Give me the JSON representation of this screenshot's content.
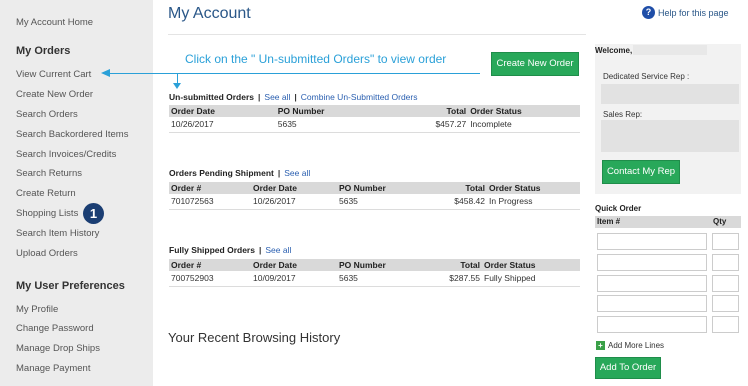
{
  "sidebar": {
    "home": "My Account Home",
    "orders_heading": "My Orders",
    "orders_items": [
      "View Current Cart",
      "Create New Order",
      "Search Orders",
      "Search Backordered Items",
      "Search Invoices/Credits",
      "Search Returns",
      "Create Return",
      "Shopping Lists",
      "Search Item History",
      "Upload Orders"
    ],
    "prefs_heading": "My User Preferences",
    "prefs_items": [
      "My Profile",
      "Change Password",
      "Manage Drop Ships",
      "Manage Payment"
    ],
    "badge": "1"
  },
  "header": {
    "title": "My Account",
    "help": "Help for this page",
    "help_icon": "?"
  },
  "callout": "Click on the \" Un-submitted Orders\" to view order",
  "create_button": "Create New Order",
  "unsubmitted": {
    "title": "Un-submitted Orders",
    "see_all": "See all",
    "combine": "Combine Un-Submitted Orders",
    "columns": [
      "Order Date",
      "PO Number",
      "Total",
      "Order Status"
    ],
    "rows": [
      [
        "10/26/2017",
        "5635",
        "$457.27",
        "Incomplete"
      ]
    ]
  },
  "pending": {
    "title": "Orders Pending Shipment",
    "see_all": "See all",
    "columns": [
      "Order #",
      "Order Date",
      "PO Number",
      "Total",
      "Order Status"
    ],
    "rows": [
      [
        "701072563",
        "10/26/2017",
        "5635",
        "$458.42",
        "In Progress"
      ]
    ]
  },
  "shipped": {
    "title": "Fully Shipped Orders",
    "see_all": "See all",
    "columns": [
      "Order #",
      "Order Date",
      "PO Number",
      "Total",
      "Order Status"
    ],
    "rows": [
      [
        "700752903",
        "10/09/2017",
        "5635",
        "$287.55",
        "Fully Shipped"
      ]
    ]
  },
  "browsing_title": "Your Recent Browsing History",
  "right": {
    "welcome": "Welcome,",
    "dedicated": "Dedicated Service Rep :",
    "sales": "Sales Rep:",
    "contact": "Contact My Rep",
    "quick_order": "Quick Order",
    "item_col": "Item #",
    "qty_col": "Qty",
    "add_lines": "Add More Lines",
    "add_icon": "+",
    "add_to_order": "Add To Order"
  },
  "colors": {
    "accent_green": "#28a85a",
    "title_blue": "#2a5788",
    "callout_blue": "#2aa0d8",
    "badge_navy": "#1b3e73"
  }
}
